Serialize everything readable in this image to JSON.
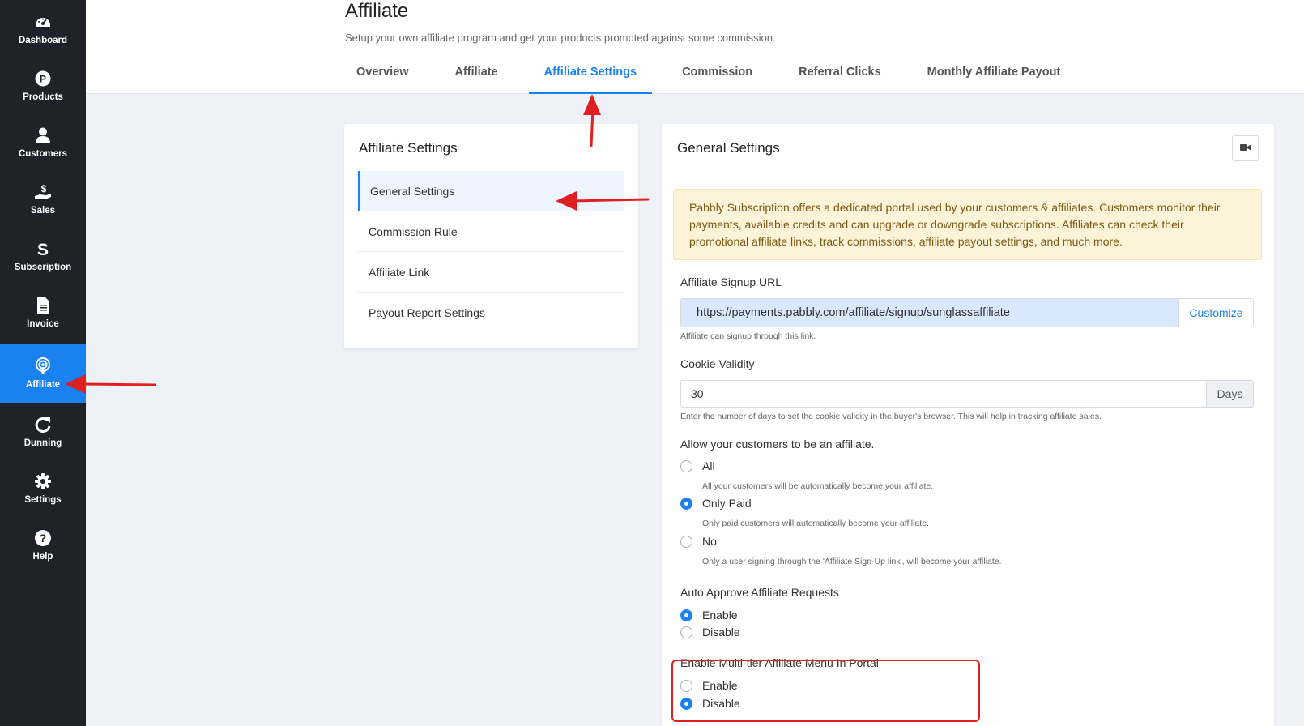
{
  "sidebar": {
    "items": [
      {
        "label": "Dashboard",
        "icon": "dashboard-gauge-icon"
      },
      {
        "label": "Products",
        "icon": "products-p-icon"
      },
      {
        "label": "Customers",
        "icon": "user-icon"
      },
      {
        "label": "Sales",
        "icon": "sales-hand-dollar-icon"
      },
      {
        "label": "Subscription",
        "icon": "subscription-s-icon"
      },
      {
        "label": "Invoice",
        "icon": "invoice-file-icon"
      },
      {
        "label": "Affiliate",
        "icon": "affiliate-podcast-icon",
        "active": true
      },
      {
        "label": "Dunning",
        "icon": "redo-icon"
      },
      {
        "label": "Settings",
        "icon": "gear-icon"
      },
      {
        "label": "Help",
        "icon": "question-circle-icon"
      }
    ]
  },
  "header": {
    "title": "Affiliate",
    "subtitle": "Setup your own affiliate program and get your products promoted against some commission.",
    "tabs": [
      {
        "label": "Overview"
      },
      {
        "label": "Affiliate"
      },
      {
        "label": "Affiliate Settings",
        "active": true
      },
      {
        "label": "Commission"
      },
      {
        "label": "Referral Clicks"
      },
      {
        "label": "Monthly Affiliate Payout"
      }
    ]
  },
  "settings_menu": {
    "title": "Affiliate Settings",
    "items": [
      {
        "label": "General Settings",
        "active": true
      },
      {
        "label": "Commission Rule"
      },
      {
        "label": "Affiliate Link"
      },
      {
        "label": "Payout Report Settings"
      }
    ]
  },
  "general": {
    "title": "General Settings",
    "video_icon": "video-camera-icon",
    "alert": "Pabbly Subscription offers a dedicated portal used by your customers & affiliates. Customers monitor their payments, available credits and can upgrade or downgrade subscriptions. Affiliates can check their promotional affiliate links, track commissions, affiliate payout settings, and much more.",
    "signup_url": {
      "label": "Affiliate Signup URL",
      "value": "https://payments.pabbly.com/affiliate/signup/sunglassaffiliate",
      "button": "Customize",
      "help": "Affiliate can signup through this link."
    },
    "cookie": {
      "label": "Cookie Validity",
      "value": "30",
      "addon": "Days",
      "help": "Enter the number of days to set the cookie validity in the buyer's browser. This will help in tracking affiliate sales."
    },
    "allow_customers": {
      "label": "Allow your customers to be an affiliate.",
      "options": [
        {
          "label": "All",
          "help": "All your customers will be automatically become your affiliate.",
          "checked": false
        },
        {
          "label": "Only Paid",
          "help": "Only paid customers will automatically become your affiliate.",
          "checked": true
        },
        {
          "label": "No",
          "help": "Only a user signing through the 'Affiliate Sign-Up link', will become your affiliate.",
          "checked": false
        }
      ]
    },
    "auto_approve": {
      "label": "Auto Approve Affiliate Requests",
      "options": [
        {
          "label": "Enable",
          "checked": true
        },
        {
          "label": "Disable",
          "checked": false
        }
      ]
    },
    "multi_tier": {
      "label": "Enable Multi-tier Affiliate Menu In Portal",
      "options": [
        {
          "label": "Enable",
          "checked": false
        },
        {
          "label": "Disable",
          "checked": true
        }
      ]
    }
  },
  "colors": {
    "sidebar_bg": "#1f2329",
    "accent": "#1a82f0",
    "alert_bg": "#fdf3d8",
    "annotation": "#e02020"
  }
}
